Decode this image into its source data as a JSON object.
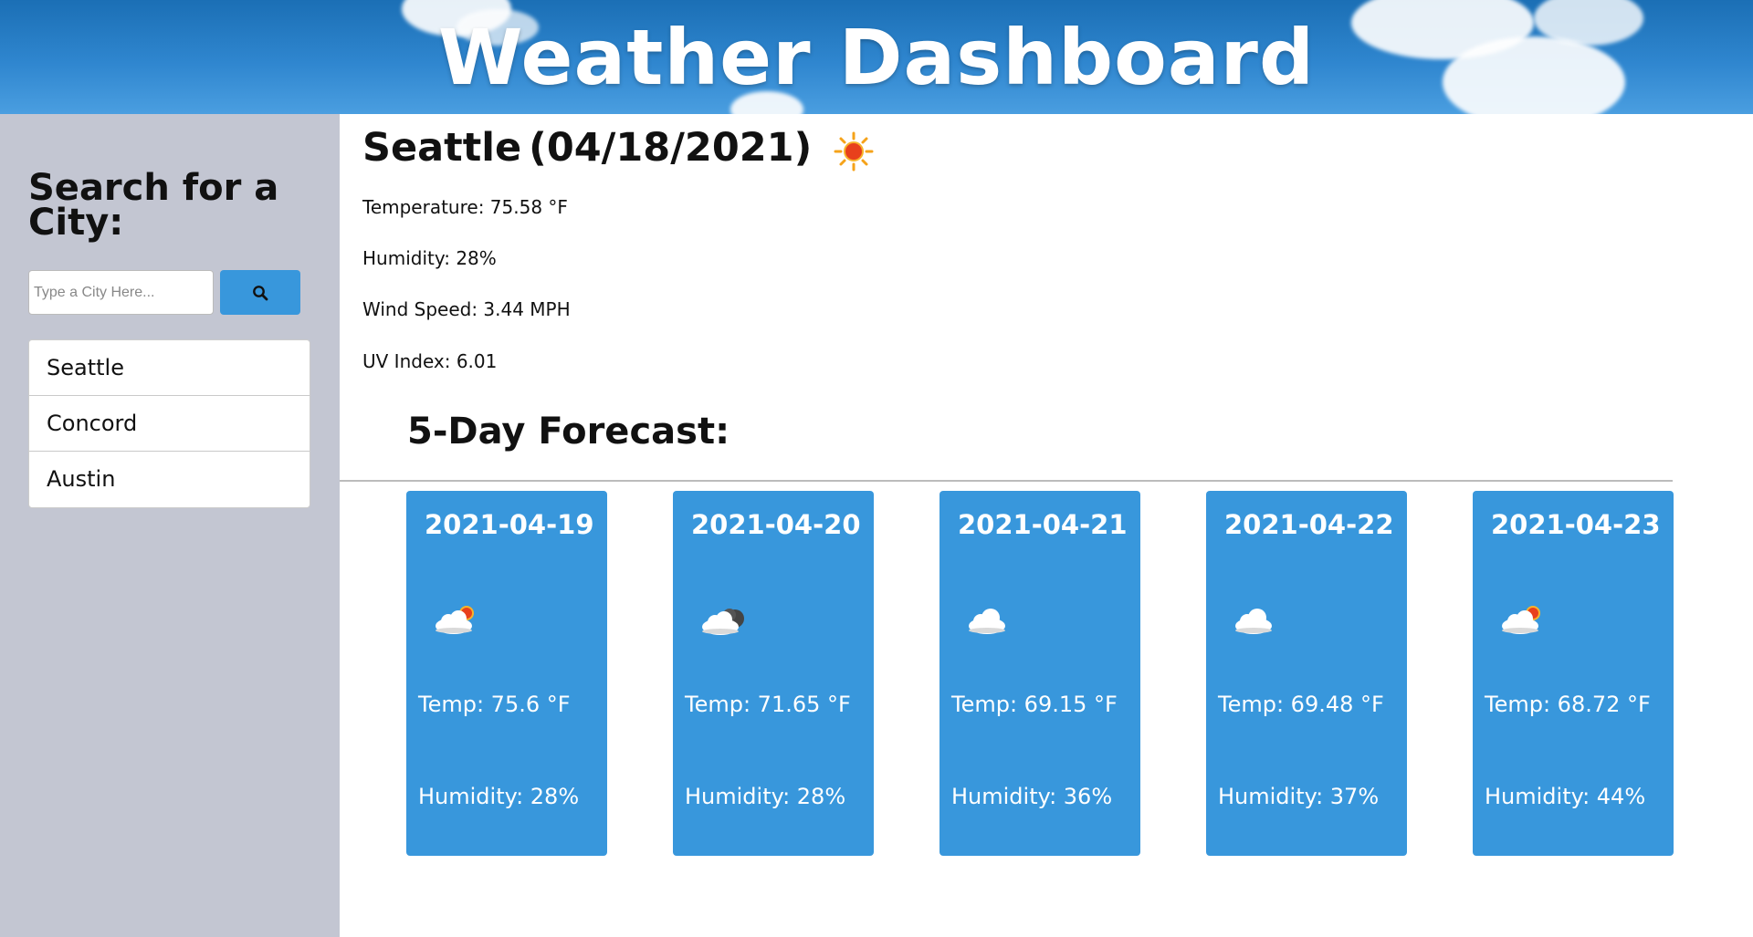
{
  "header": {
    "title": "Weather Dashboard"
  },
  "sidebar": {
    "heading": "Search for a City:",
    "search_placeholder": "Type a City Here...",
    "history": [
      "Seattle",
      "Concord",
      "Austin"
    ]
  },
  "current": {
    "city": "Seattle",
    "date": "(04/18/2021)",
    "icon": "sun-icon",
    "temperature": "Temperature: 75.58 °F",
    "humidity": "Humidity: 28%",
    "wind": "Wind Speed: 3.44 MPH",
    "uv": "UV Index: 6.01"
  },
  "forecast": {
    "heading": "5-Day Forecast:",
    "days": [
      {
        "date": "2021-04-19",
        "icon": "partly-cloudy-icon",
        "temp": "Temp: 75.6 °F",
        "humidity": "Humidity: 28%"
      },
      {
        "date": "2021-04-20",
        "icon": "cloudy-night-icon",
        "temp": "Temp: 71.65 °F",
        "humidity": "Humidity: 28%"
      },
      {
        "date": "2021-04-21",
        "icon": "cloud-icon",
        "temp": "Temp: 69.15 °F",
        "humidity": "Humidity: 36%"
      },
      {
        "date": "2021-04-22",
        "icon": "cloud-icon",
        "temp": "Temp: 69.48 °F",
        "humidity": "Humidity: 37%"
      },
      {
        "date": "2021-04-23",
        "icon": "partly-cloudy-icon",
        "temp": "Temp: 68.72 °F",
        "humidity": "Humidity: 44%"
      }
    ]
  },
  "colors": {
    "accent": "#3897dc",
    "sidebar": "#c3c6d2",
    "header": "#2f86cf"
  }
}
